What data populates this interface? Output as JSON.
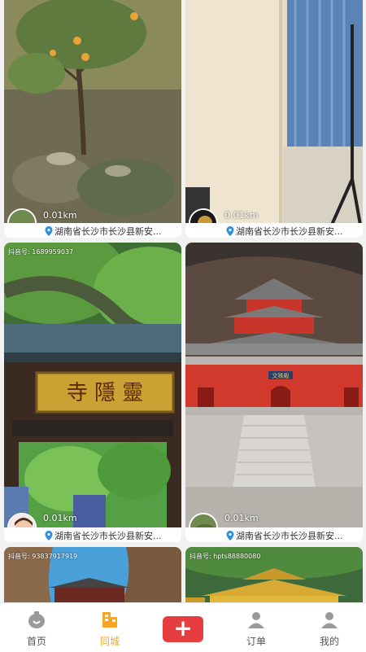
{
  "feed": {
    "cards": [
      {
        "distance": "0.01km",
        "location": "湖南省长沙市长沙县新安...",
        "watermark": ""
      },
      {
        "distance": "0.01km",
        "location": "湖南省长沙市长沙县新安...",
        "watermark": ""
      },
      {
        "distance": "0.01km",
        "location": "湖南省长沙市长沙县新安...",
        "watermark": "抖音号: 1689959037"
      },
      {
        "distance": "0.01km",
        "location": "湖南省长沙市长沙县新安...",
        "watermark": ""
      },
      {
        "distance": "",
        "location": "",
        "watermark": "抖音号: 93837917919"
      },
      {
        "distance": "",
        "location": "",
        "watermark": "抖音号: hpts88880080"
      }
    ],
    "scenes": {
      "temple_sign": "寺 隱 靈",
      "temple_tablet": "文殊殿"
    }
  },
  "tabbar": {
    "items": [
      {
        "label": "首页",
        "icon": "home-icon"
      },
      {
        "label": "同城",
        "icon": "city-icon"
      },
      {
        "label": "",
        "icon": "plus-icon"
      },
      {
        "label": "订单",
        "icon": "orders-icon"
      },
      {
        "label": "我的",
        "icon": "profile-icon"
      }
    ],
    "active_color": "#f5a623",
    "publish_color": "#e63e3e"
  }
}
